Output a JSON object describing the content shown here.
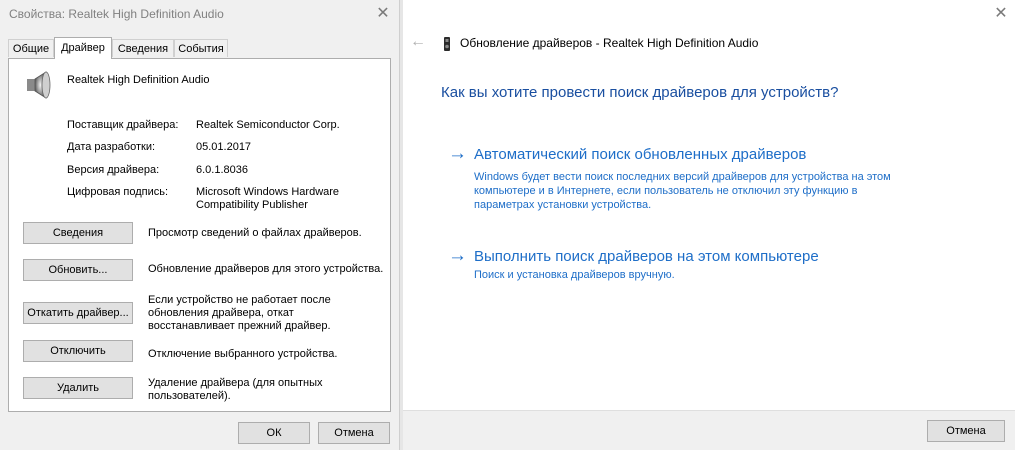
{
  "left_dialog": {
    "title": "Свойства: Realtek High Definition Audio",
    "tabs": [
      {
        "label": "Общие"
      },
      {
        "label": "Драйвер"
      },
      {
        "label": "Сведения"
      },
      {
        "label": "События"
      }
    ],
    "active_tab": "Драйвер",
    "device_name": "Realtek High Definition Audio",
    "info": [
      {
        "label": "Поставщик драйвера:",
        "value": "Realtek Semiconductor Corp."
      },
      {
        "label": "Дата разработки:",
        "value": "05.01.2017"
      },
      {
        "label": "Версия драйвера:",
        "value": "6.0.1.8036"
      },
      {
        "label": "Цифровая подпись:",
        "value": "Microsoft Windows Hardware Compatibility Publisher"
      }
    ],
    "actions": [
      {
        "button": "Сведения",
        "desc": "Просмотр сведений о файлах драйверов."
      },
      {
        "button": "Обновить...",
        "desc": "Обновление драйверов для этого устройства."
      },
      {
        "button": "Откатить драйвер...",
        "desc": "Если устройство не работает после обновления драйвера, откат восстанавливает прежний драйвер."
      },
      {
        "button": "Отключить",
        "desc": "Отключение выбранного устройства."
      },
      {
        "button": "Удалить",
        "desc": "Удаление драйвера (для опытных пользователей)."
      }
    ],
    "ok_label": "ОК",
    "cancel_label": "Отмена"
  },
  "wizard": {
    "title": "Обновление драйверов - Realtek High Definition Audio",
    "question": "Как вы хотите провести поиск драйверов для устройств?",
    "options": [
      {
        "title": "Автоматический поиск обновленных драйверов",
        "desc": "Windows будет вести поиск последних версий драйверов для устройства на этом компьютере и в Интернете, если пользователь не отключил эту функцию в параметрах установки устройства."
      },
      {
        "title": "Выполнить поиск драйверов на этом компьютере",
        "desc": "Поиск и установка драйверов вручную."
      }
    ],
    "cancel_label": "Отмена"
  },
  "icons": {
    "close": "close-icon",
    "back": "back-arrow-icon",
    "speaker": "speaker-icon",
    "device": "audio-device-icon",
    "option_arrow": "arrow-right-icon"
  },
  "colors": {
    "link_blue": "#1e6ec8",
    "heading_blue": "#1a4fa0",
    "dialog_bg": "#f0f0f0",
    "button_bg": "#e1e1e1"
  }
}
